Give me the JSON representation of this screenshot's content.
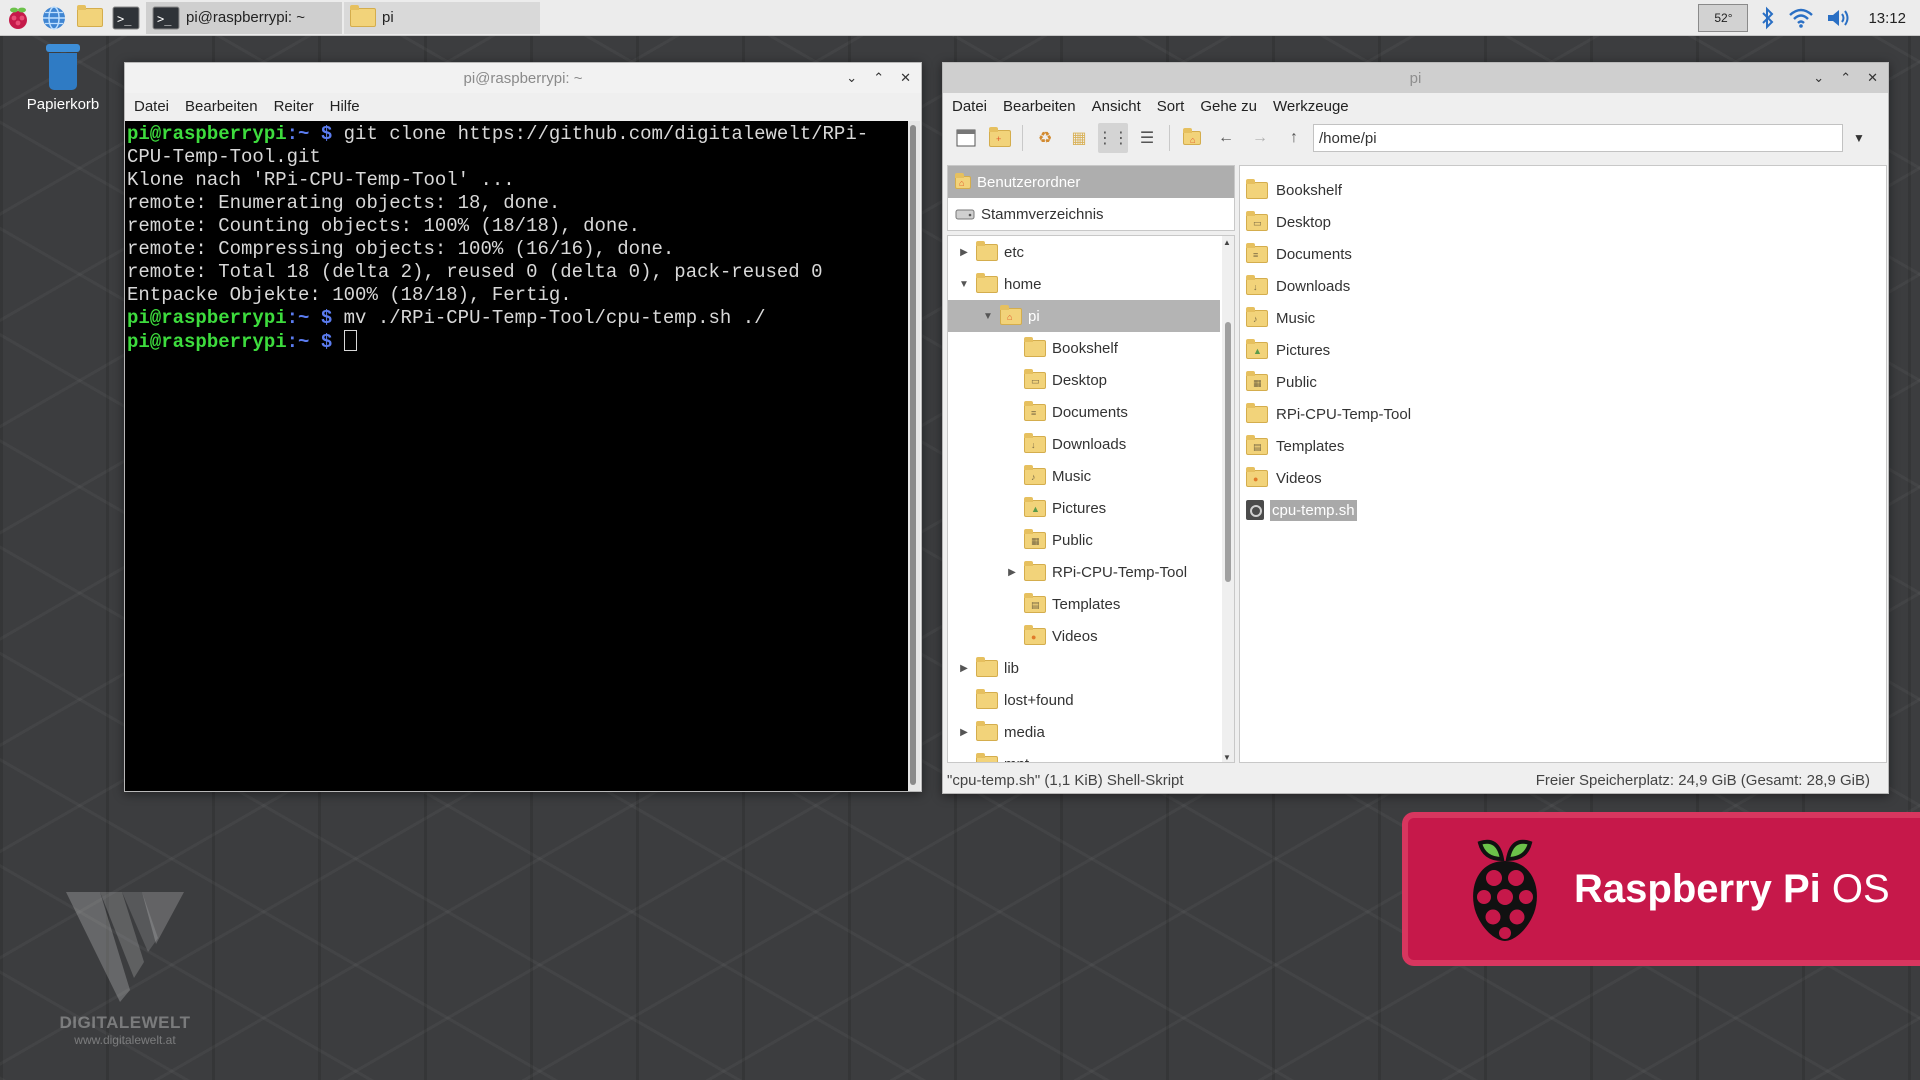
{
  "taskbar": {
    "tasks": [
      {
        "label": "pi@raspberrypi: ~",
        "kind": "terminal"
      },
      {
        "label": "pi",
        "kind": "folder"
      }
    ],
    "cpu_temp": "52°",
    "clock": "13:12"
  },
  "desktop": {
    "trash_label": "Papierkorb"
  },
  "terminal": {
    "title": "pi@raspberrypi: ~",
    "menu": [
      "Datei",
      "Bearbeiten",
      "Reiter",
      "Hilfe"
    ],
    "prompt_user": "pi@raspberrypi",
    "prompt_path": ":~ $",
    "lines": [
      {
        "type": "cmd",
        "text": " git clone https://github.com/digitalewelt/RPi-CPU-Temp-Tool.git"
      },
      {
        "type": "out",
        "text": "Klone nach 'RPi-CPU-Temp-Tool' ..."
      },
      {
        "type": "out",
        "text": "remote: Enumerating objects: 18, done."
      },
      {
        "type": "out",
        "text": "remote: Counting objects: 100% (18/18), done."
      },
      {
        "type": "out",
        "text": "remote: Compressing objects: 100% (16/16), done."
      },
      {
        "type": "out",
        "text": "remote: Total 18 (delta 2), reused 0 (delta 0), pack-reused 0"
      },
      {
        "type": "out",
        "text": "Entpacke Objekte: 100% (18/18), Fertig."
      },
      {
        "type": "cmd",
        "text": " mv ./RPi-CPU-Temp-Tool/cpu-temp.sh ./"
      },
      {
        "type": "cmd",
        "text": " "
      }
    ]
  },
  "filemanager": {
    "title": "pi",
    "menu": [
      "Datei",
      "Bearbeiten",
      "Ansicht",
      "Sort",
      "Gehe zu",
      "Werkzeuge"
    ],
    "path": "/home/pi",
    "places": [
      {
        "label": "Benutzerordner",
        "selected": true
      },
      {
        "label": "Stammverzeichnis",
        "selected": false
      }
    ],
    "tree": [
      {
        "label": "etc",
        "level": 0,
        "arrow": "▶",
        "selected": false
      },
      {
        "label": "home",
        "level": 0,
        "arrow": "▼",
        "selected": false
      },
      {
        "label": "pi",
        "level": 1,
        "arrow": "▼",
        "selected": true
      },
      {
        "label": "Bookshelf",
        "level": 2,
        "arrow": "",
        "selected": false
      },
      {
        "label": "Desktop",
        "level": 2,
        "arrow": "",
        "selected": false
      },
      {
        "label": "Documents",
        "level": 2,
        "arrow": "",
        "selected": false
      },
      {
        "label": "Downloads",
        "level": 2,
        "arrow": "",
        "selected": false
      },
      {
        "label": "Music",
        "level": 2,
        "arrow": "",
        "selected": false
      },
      {
        "label": "Pictures",
        "level": 2,
        "arrow": "",
        "selected": false
      },
      {
        "label": "Public",
        "level": 2,
        "arrow": "",
        "selected": false
      },
      {
        "label": "RPi-CPU-Temp-Tool",
        "level": 2,
        "arrow": "▶",
        "selected": false
      },
      {
        "label": "Templates",
        "level": 2,
        "arrow": "",
        "selected": false
      },
      {
        "label": "Videos",
        "level": 2,
        "arrow": "",
        "selected": false
      },
      {
        "label": "lib",
        "level": 0,
        "arrow": "▶",
        "selected": false
      },
      {
        "label": "lost+found",
        "level": 0,
        "arrow": "",
        "selected": false
      },
      {
        "label": "media",
        "level": 0,
        "arrow": "▶",
        "selected": false
      },
      {
        "label": "mnt",
        "level": 0,
        "arrow": "",
        "selected": false
      }
    ],
    "files": [
      {
        "label": "Bookshelf",
        "kind": "folder",
        "selected": false
      },
      {
        "label": "Desktop",
        "kind": "folder",
        "selected": false
      },
      {
        "label": "Documents",
        "kind": "folder",
        "selected": false
      },
      {
        "label": "Downloads",
        "kind": "folder",
        "selected": false
      },
      {
        "label": "Music",
        "kind": "folder",
        "selected": false
      },
      {
        "label": "Pictures",
        "kind": "folder",
        "selected": false
      },
      {
        "label": "Public",
        "kind": "folder",
        "selected": false
      },
      {
        "label": "RPi-CPU-Temp-Tool",
        "kind": "folder",
        "selected": false
      },
      {
        "label": "Templates",
        "kind": "folder",
        "selected": false
      },
      {
        "label": "Videos",
        "kind": "folder",
        "selected": false
      },
      {
        "label": "cpu-temp.sh",
        "kind": "script",
        "selected": true
      }
    ],
    "status_left": "\"cpu-temp.sh\" (1,1 KiB) Shell-Skript",
    "status_right": "Freier Speicherplatz: 24,9 GiB (Gesamt: 28,9 GiB)"
  },
  "branding": {
    "rpi_name": "Raspberry Pi",
    "rpi_os": "OS",
    "dw_name": "DIGITALEWELT",
    "dw_url": "www.digitalewelt.at"
  },
  "colors": {
    "desktop_bg": "#3c3d3f",
    "rpi_red": "#c6184a",
    "prompt_green": "#3ddc3d",
    "prompt_blue": "#5b7cf0"
  }
}
